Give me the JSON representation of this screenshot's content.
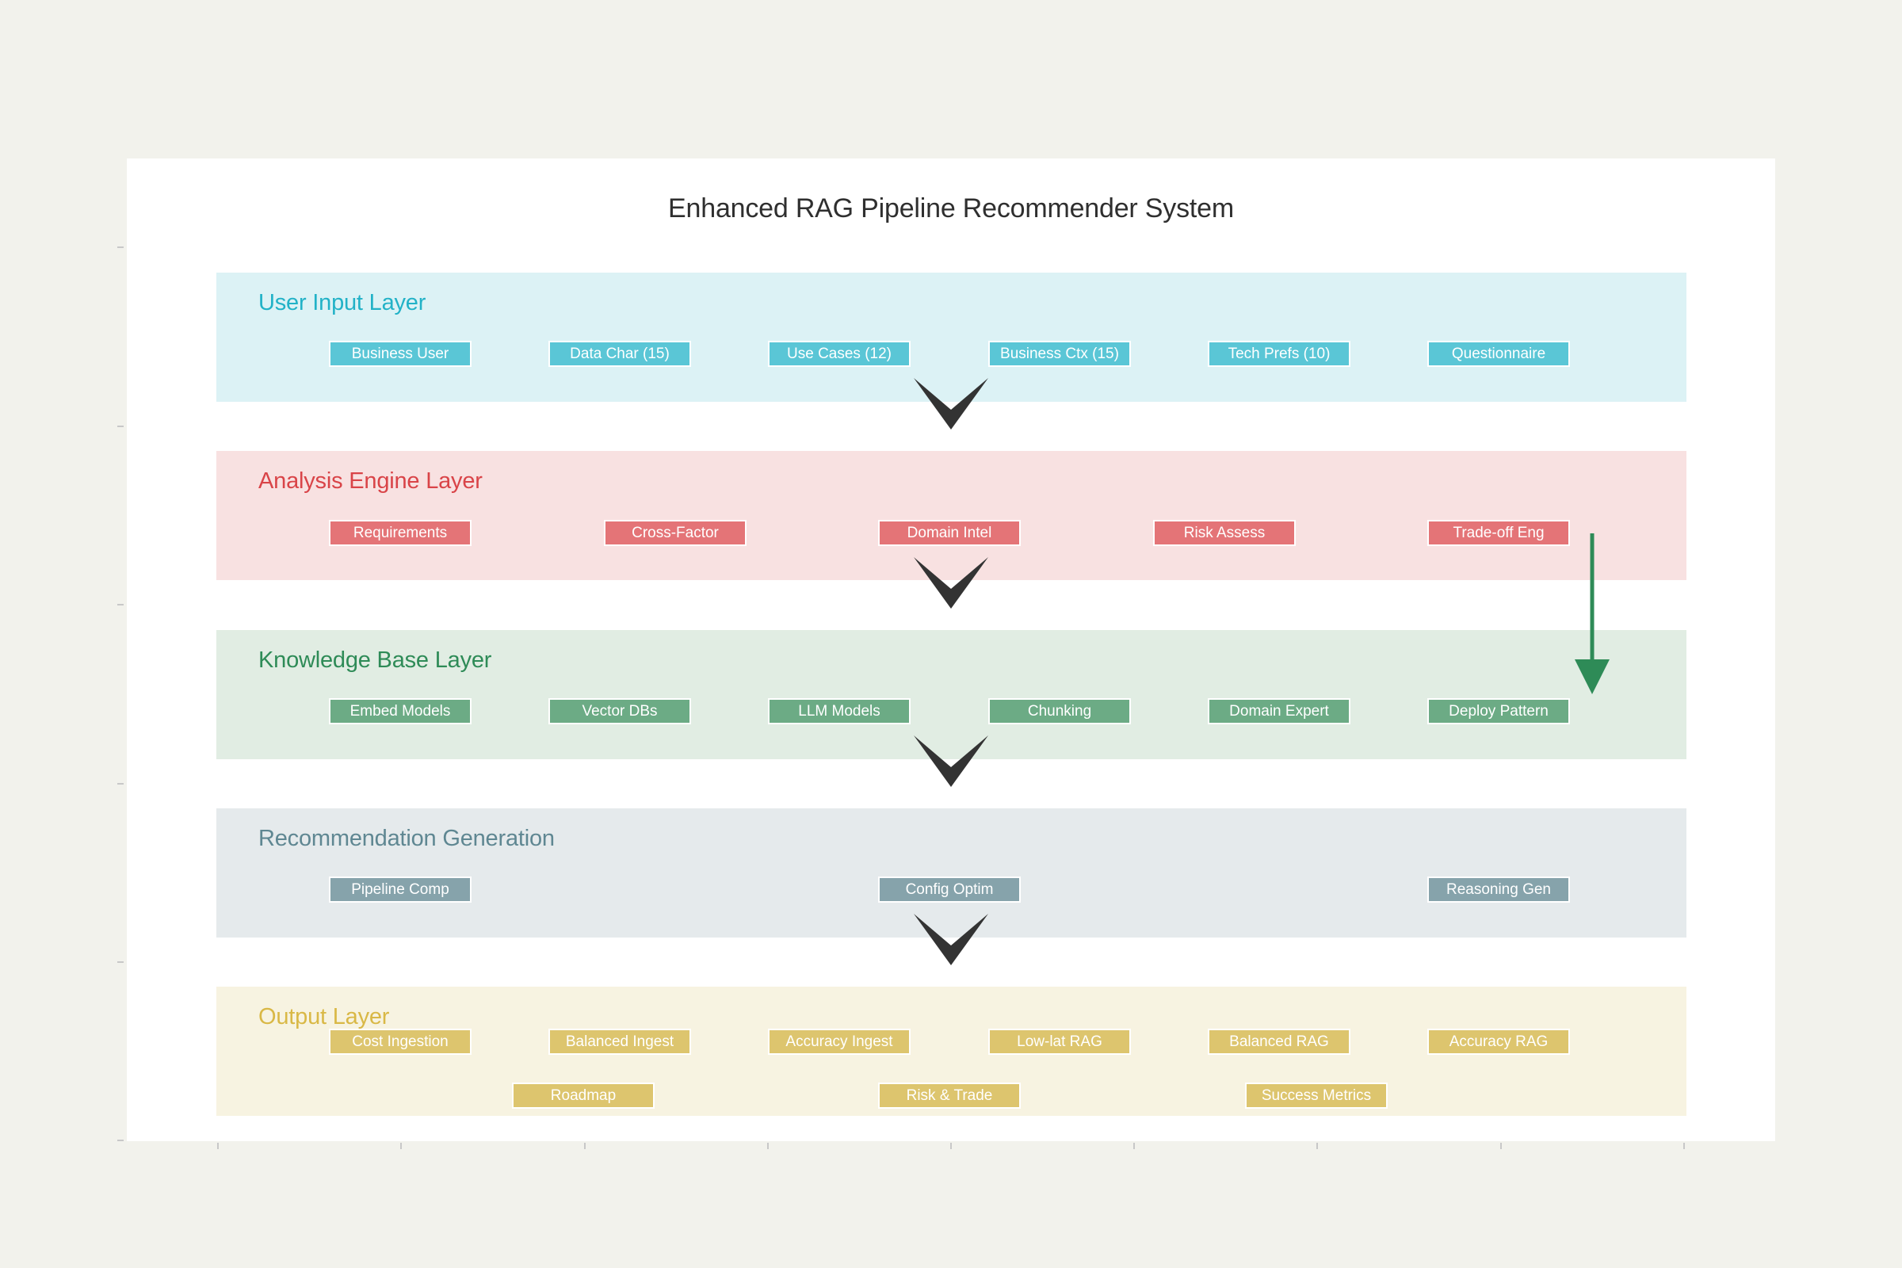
{
  "title": "Enhanced RAG Pipeline Recommender System",
  "colors": {
    "user_input": {
      "band": "#dcf2f5",
      "node": "#5ac6d6",
      "title": "#22b2c7"
    },
    "analysis": {
      "band": "#f8e1e1",
      "node": "#e47477",
      "title": "#d94448"
    },
    "knowledge": {
      "band": "#e1ede3",
      "node": "#6cab85",
      "title": "#2e8b57"
    },
    "recommendation": {
      "band": "#e5eaec",
      "node": "#86a3ab",
      "title": "#5f8792"
    },
    "output": {
      "band": "#f7f3e1",
      "node": "#ddc56e",
      "title": "#d9b846"
    },
    "flow_arrow": "#333333",
    "feedback_arrow": "#2e8b57"
  },
  "layers": {
    "user_input": {
      "title": "User Input Layer",
      "nodes": [
        "Business User",
        "Data Char (15)",
        "Use Cases (12)",
        "Business Ctx (15)",
        "Tech Prefs (10)",
        "Questionnaire"
      ]
    },
    "analysis": {
      "title": "Analysis Engine Layer",
      "nodes": [
        "Requirements",
        "Cross-Factor",
        "Domain Intel",
        "Risk Assess",
        "Trade-off Eng"
      ]
    },
    "knowledge": {
      "title": "Knowledge Base Layer",
      "nodes": [
        "Embed Models",
        "Vector DBs",
        "LLM Models",
        "Chunking",
        "Domain Expert",
        "Deploy Pattern"
      ]
    },
    "recommendation": {
      "title": "Recommendation Generation",
      "nodes": [
        "Pipeline Comp",
        "Config Optim",
        "Reasoning Gen"
      ]
    },
    "output": {
      "title": "Output Layer",
      "nodes": [
        "Cost Ingestion",
        "Balanced Ingest",
        "Accuracy Ingest",
        "Low-lat RAG",
        "Balanced RAG",
        "Accuracy RAG"
      ],
      "nodes_row2": [
        "Roadmap",
        "Risk & Trade",
        "Success Metrics"
      ]
    }
  },
  "connections": [
    {
      "from": "User Input Layer",
      "to": "Analysis Engine Layer",
      "type": "flow"
    },
    {
      "from": "Analysis Engine Layer",
      "to": "Knowledge Base Layer",
      "type": "flow"
    },
    {
      "from": "Knowledge Base Layer",
      "to": "Recommendation Generation",
      "type": "flow"
    },
    {
      "from": "Recommendation Generation",
      "to": "Output Layer",
      "type": "flow"
    },
    {
      "from": "Trade-off Eng",
      "to": "Deploy Pattern",
      "type": "feedback"
    }
  ]
}
